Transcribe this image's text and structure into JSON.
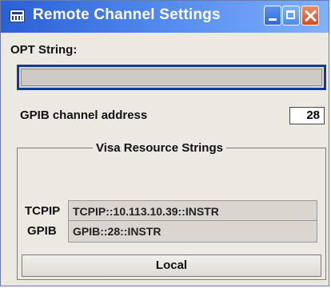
{
  "window": {
    "title": "Remote Channel Settings",
    "colors": {
      "titlebar": "#2b5fd6",
      "close": "#d8491f",
      "panel": "#ece9e3",
      "focus_border": "#123a96"
    }
  },
  "opt_string": {
    "label": "OPT String:",
    "value": ""
  },
  "gpib_channel": {
    "label": "GPIB channel address",
    "value": "28"
  },
  "visa": {
    "group_title": "Visa Resource Strings",
    "tcpip": {
      "label": "TCPIP",
      "value": "TCPIP::10.113.10.39::INSTR"
    },
    "gpib": {
      "label": "GPIB",
      "value": "GPIB::28::INSTR"
    }
  },
  "local_button": {
    "label": "Local"
  }
}
